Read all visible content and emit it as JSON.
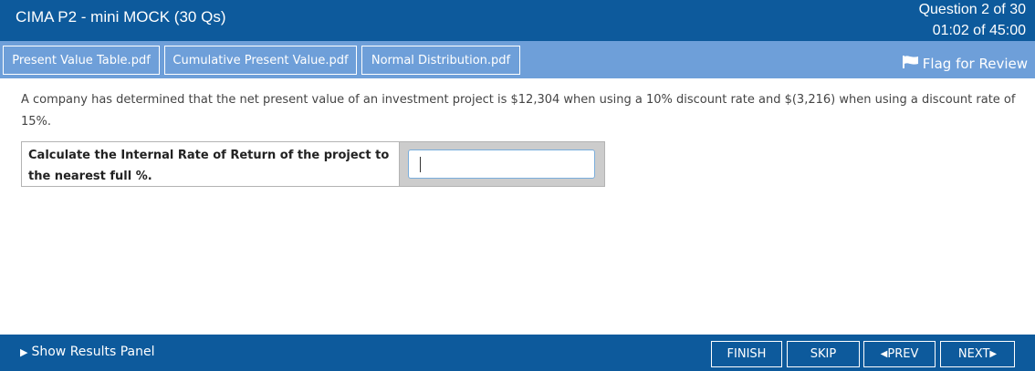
{
  "header": {
    "title": "CIMA P2 - mini MOCK (30 Qs)",
    "question_counter": "Question 2 of 30",
    "timer": "01:02 of 45:00"
  },
  "resources": {
    "items": [
      {
        "label": "Present Value Table.pdf"
      },
      {
        "label": "Cumulative Present Value.pdf"
      },
      {
        "label": "Normal Distribution.pdf"
      }
    ],
    "flag_label": "Flag for Review",
    "flag_icon": "flag-icon"
  },
  "question": {
    "text": "A company has determined that the net present value of an investment project is $12,304 when using a 10% discount rate and $(3,216) when using a discount rate of 15%.",
    "prompt": "Calculate the Internal Rate of Return of the project to the nearest full %.",
    "answer_value": ""
  },
  "footer": {
    "results_panel_label": "Show Results Panel",
    "finish_label": "FINISH",
    "skip_label": "SKIP",
    "prev_label": "PREV",
    "next_label": "NEXT"
  },
  "colors": {
    "header_bg": "#0d5a9c",
    "resource_bar_bg": "#6e9fd9",
    "answer_cell_bg": "#cccccc"
  }
}
